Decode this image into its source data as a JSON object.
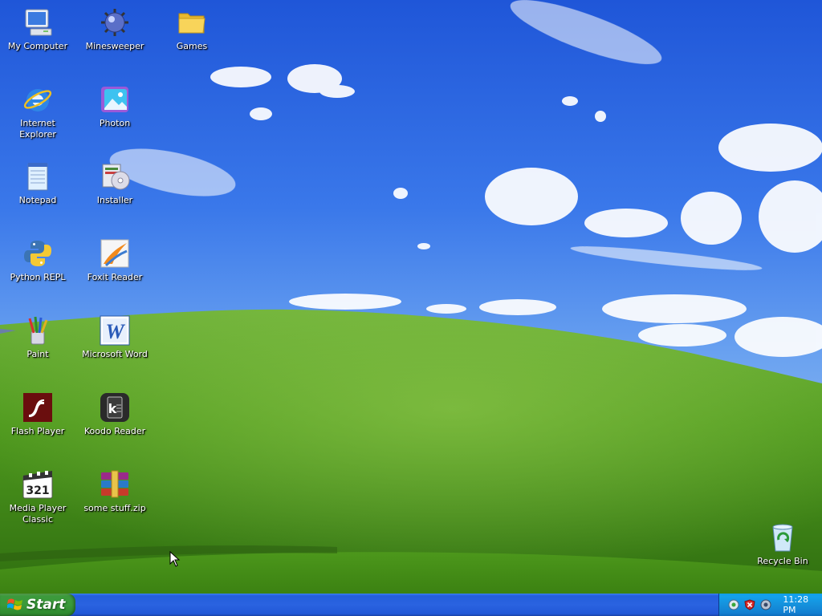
{
  "desktop_icons": [
    {
      "label": "My Computer",
      "icon": "computer-icon"
    },
    {
      "label": "Minesweeper",
      "icon": "mine-icon"
    },
    {
      "label": "Games",
      "icon": "folder-icon"
    },
    {
      "label": "Internet Explorer",
      "icon": "internet-explorer-icon"
    },
    {
      "label": "Photon",
      "icon": "photo-icon"
    },
    {
      "label": "Notepad",
      "icon": "notepad-icon"
    },
    {
      "label": "Installer",
      "icon": "installer-icon"
    },
    {
      "label": "Python REPL",
      "icon": "python-icon"
    },
    {
      "label": "Foxit Reader",
      "icon": "foxit-icon"
    },
    {
      "label": "Paint",
      "icon": "paint-icon"
    },
    {
      "label": "Microsoft Word",
      "icon": "word-icon"
    },
    {
      "label": "Flash Player",
      "icon": "flash-icon"
    },
    {
      "label": "Koodo Reader",
      "icon": "koodo-icon"
    },
    {
      "label": "Media Player Classic",
      "icon": "media-player-icon"
    },
    {
      "label": "some stuff.zip",
      "icon": "zip-archive-icon"
    },
    {
      "label": "Recycle Bin",
      "icon": "recycle-bin-icon"
    }
  ],
  "taskbar": {
    "start_label": "Start",
    "clock": "11:28 PM",
    "tray_icons": [
      "network-icon",
      "security-alert-icon",
      "volume-icon"
    ]
  },
  "colors": {
    "sky": "#2f63e0",
    "hill": "#5da524",
    "taskbar": "#245edb",
    "start": "#3c9a3c",
    "tray": "#1591dc"
  }
}
